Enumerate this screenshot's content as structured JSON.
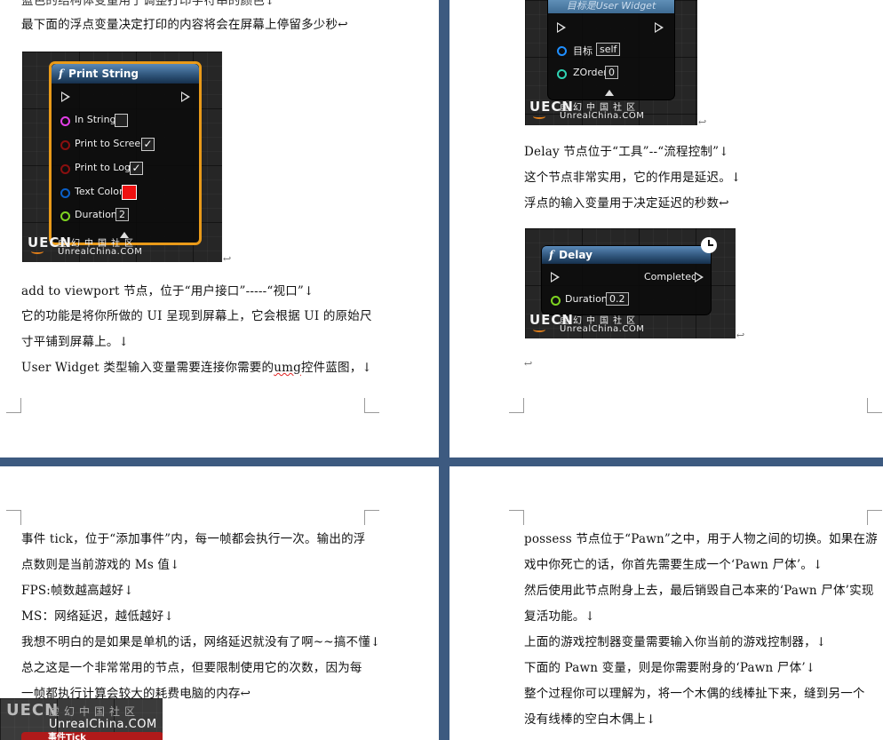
{
  "page1": {
    "line0": "蓝色的结构体变量用于调整打印字符串的颜色↓",
    "line1": "最下面的浮点变量决定打印的内容将会在屏幕上停留多少秒↩",
    "print_string": {
      "title": "Print String",
      "fn_glyph": "f",
      "pins": [
        "In String",
        "Print to Screen",
        "Print to Log",
        "Text Color",
        "Duration"
      ],
      "duration_value": "2",
      "checkmark": "✓"
    },
    "lines": [
      "add to viewport 节点，位于“用户接口”-----“视口”↓",
      "它的功能是将你所做的 UI 呈现到屏幕上，它会根据 UI 的原始尺",
      "寸平铺到屏幕上。↓"
    ],
    "last_line_prefix": "User Widget 类型输入变量需要连接你需要的",
    "last_line_word": "umg",
    "last_line_suffix": "控件蓝图，↓"
  },
  "page2": {
    "widget_node": {
      "subtitle": "目标是User Widget",
      "pins": [
        "目标",
        "ZOrder"
      ],
      "target_value": "self",
      "zorder_value": "0"
    },
    "lines": [
      "Delay 节点位于“工具”--“流程控制”↓",
      "这个节点非常实用，它的作用是延迟。↓",
      "浮点的输入变量用于决定延迟的秒数↩"
    ],
    "delay_node": {
      "title": "Delay",
      "fn_glyph": "f",
      "completed": "Completed",
      "pin": "Duration",
      "duration_value": "0.2"
    },
    "para_mark": "↩"
  },
  "page3": {
    "lines": [
      "事件 tick，位于“添加事件”内，每一帧都会执行一次。输出的浮",
      "点数则是当前游戏的 Ms 值↓",
      "FPS:帧数越高越好↓",
      "MS：网络延迟，越低越好↓",
      "我想不明白的是如果是单机的话，网络延迟就没有了啊~~搞不懂↓",
      "总之这是一个非常常用的节点，但要限制使用它的次数，因为每",
      "一帧都执行计算会较大的耗费电脑的内存↩"
    ],
    "event_tick_label": "事件Tick"
  },
  "page4": {
    "lines": [
      "possess 节点位于“Pawn”之中，用于人物之间的切换。如果在游",
      "戏中你死亡的话，你首先需要生成一个‘Pawn 尸体’。↓",
      "然后使用此节点附身上去，最后销毁自己本来的‘Pawn 尸体’实现",
      "复活功能。↓",
      "上面的游戏控制器变量需要输入你当前的游戏控制器，↓",
      "下面的 Pawn 变量，则是你需要附身的‘Pawn 尸体’↓",
      "整个过程你可以理解为，将一个木偶的线棒扯下来，缝到另一个",
      "没有线棒的空白木偶上↓"
    ]
  },
  "watermark": {
    "logo": "UECN",
    "cn": "虚幻中国社区",
    "url": "UnrealChina.COM"
  },
  "colors": {
    "background": "#3d5a80",
    "node_header": "#2d5277",
    "selection": "#e99a19",
    "text_color_value": "#ee1111"
  }
}
